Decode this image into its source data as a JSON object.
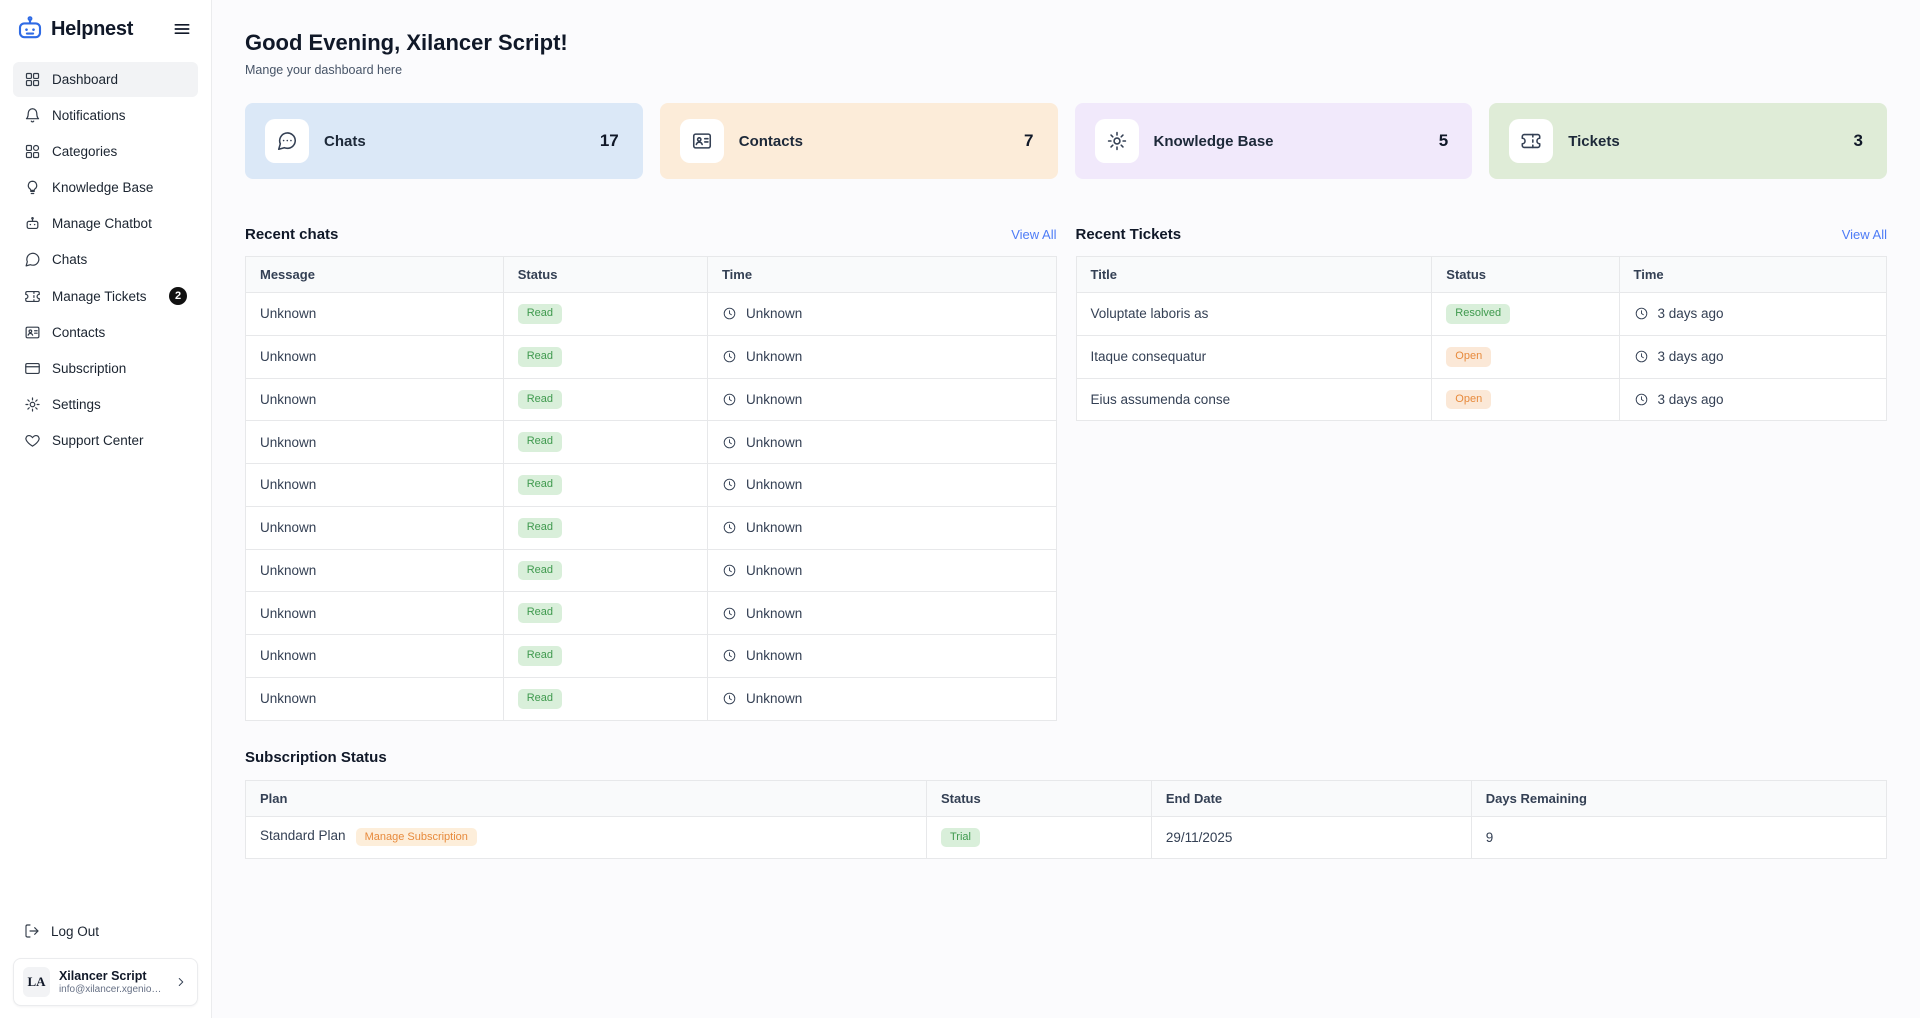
{
  "sidebar": {
    "logo_text": "Helpnest",
    "items": [
      {
        "label": "Dashboard",
        "icon": "grid",
        "active": true
      },
      {
        "label": "Notifications",
        "icon": "bell"
      },
      {
        "label": "Categories",
        "icon": "categories-grid"
      },
      {
        "label": "Knowledge Base",
        "icon": "lightbulb"
      },
      {
        "label": "Manage Chatbot",
        "icon": "robot"
      },
      {
        "label": "Chats",
        "icon": "chat-bubble"
      },
      {
        "label": "Manage Tickets",
        "icon": "ticket",
        "badge": "2"
      },
      {
        "label": "Contacts",
        "icon": "id-card"
      },
      {
        "label": "Subscription",
        "icon": "credit-card"
      },
      {
        "label": "Settings",
        "icon": "gear"
      },
      {
        "label": "Support Center",
        "icon": "heart"
      }
    ],
    "logout_label": "Log Out",
    "user": {
      "initials": "LA",
      "name": "Xilancer Script",
      "email": "info@xilancer.xgenious.com"
    }
  },
  "header": {
    "greeting": "Good Evening, Xilancer Script!",
    "subtitle": "Mange your dashboard here"
  },
  "stat_cards": [
    {
      "label": "Chats",
      "value": "17",
      "icon": "chat-bubble",
      "bg": "#dbe8f7"
    },
    {
      "label": "Contacts",
      "value": "7",
      "icon": "id-card",
      "bg": "#fcecd9"
    },
    {
      "label": "Knowledge Base",
      "value": "5",
      "icon": "sun-bulb",
      "bg": "#f1e9fb"
    },
    {
      "label": "Tickets",
      "value": "3",
      "icon": "ticket",
      "bg": "#dfecd7"
    }
  ],
  "recent_chats": {
    "title": "Recent chats",
    "view_all": "View All",
    "columns": [
      "Message",
      "Status",
      "Time"
    ],
    "rows": [
      {
        "message": "Unknown",
        "status": "Read",
        "status_type": "success",
        "time": "Unknown"
      },
      {
        "message": "Unknown",
        "status": "Read",
        "status_type": "success",
        "time": "Unknown"
      },
      {
        "message": "Unknown",
        "status": "Read",
        "status_type": "success",
        "time": "Unknown"
      },
      {
        "message": "Unknown",
        "status": "Read",
        "status_type": "success",
        "time": "Unknown"
      },
      {
        "message": "Unknown",
        "status": "Read",
        "status_type": "success",
        "time": "Unknown"
      },
      {
        "message": "Unknown",
        "status": "Read",
        "status_type": "success",
        "time": "Unknown"
      },
      {
        "message": "Unknown",
        "status": "Read",
        "status_type": "success",
        "time": "Unknown"
      },
      {
        "message": "Unknown",
        "status": "Read",
        "status_type": "success",
        "time": "Unknown"
      },
      {
        "message": "Unknown",
        "status": "Read",
        "status_type": "success",
        "time": "Unknown"
      },
      {
        "message": "Unknown",
        "status": "Read",
        "status_type": "success",
        "time": "Unknown"
      }
    ]
  },
  "recent_tickets": {
    "title": "Recent Tickets",
    "view_all": "View All",
    "columns": [
      "Title",
      "Status",
      "Time"
    ],
    "rows": [
      {
        "title": "Voluptate laboris as",
        "status": "Resolved",
        "status_type": "success",
        "time": "3 days ago"
      },
      {
        "title": "Itaque consequatur",
        "status": "Open",
        "status_type": "warning",
        "time": "3 days ago"
      },
      {
        "title": "Eius assumenda conse",
        "status": "Open",
        "status_type": "warning",
        "time": "3 days ago"
      }
    ]
  },
  "subscription": {
    "title": "Subscription Status",
    "columns": [
      "Plan",
      "Status",
      "End Date",
      "Days Remaining"
    ],
    "row": {
      "plan": "Standard Plan",
      "manage_label": "Manage Subscription",
      "status": "Trial",
      "status_type": "success",
      "end_date": "29/11/2025",
      "days_remaining": "9"
    }
  },
  "colors": {
    "logo_blue": "#2f6be5",
    "link_blue": "#4e7cf6",
    "badge_success_bg": "#d9efda",
    "badge_success_text": "#3f9a4e",
    "badge_warning_bg": "#fbe8d7",
    "badge_warning_text": "#e78a3c",
    "card_chats_bg": "#dbe8f7",
    "card_contacts_bg": "#fcecd9",
    "card_knowledge_base_bg": "#f1e9fb",
    "card_tickets_bg": "#dfecd7",
    "count_badge_bg": "#111111"
  }
}
